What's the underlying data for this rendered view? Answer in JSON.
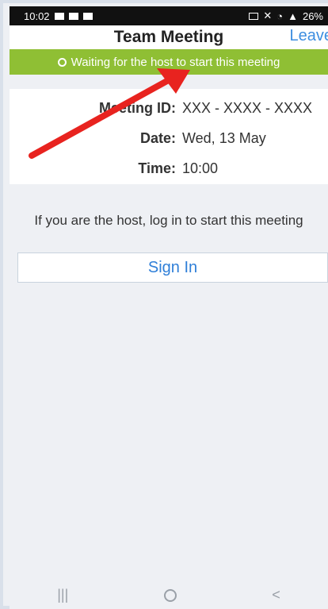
{
  "status_bar": {
    "time": "10:02",
    "battery": "26%"
  },
  "header": {
    "title": "Team Meeting",
    "leave_label": "Leave"
  },
  "banner": {
    "text": "Waiting for the host to start this meeting"
  },
  "meeting": {
    "id_label": "Meeting ID:",
    "id_value": "XXX - XXXX - XXXX",
    "date_label": "Date:",
    "date_value": "Wed, 13 May",
    "time_label": "Time:",
    "time_value": "10:00"
  },
  "host_message": "If you are the host, log in to start this meeting",
  "sign_in_label": "Sign In",
  "nav": {
    "recent": "|||",
    "back": "<"
  },
  "annotation": {
    "arrow_color": "#e8231f"
  },
  "colors": {
    "banner": "#8fbf34",
    "accent": "#2f7fd8"
  }
}
